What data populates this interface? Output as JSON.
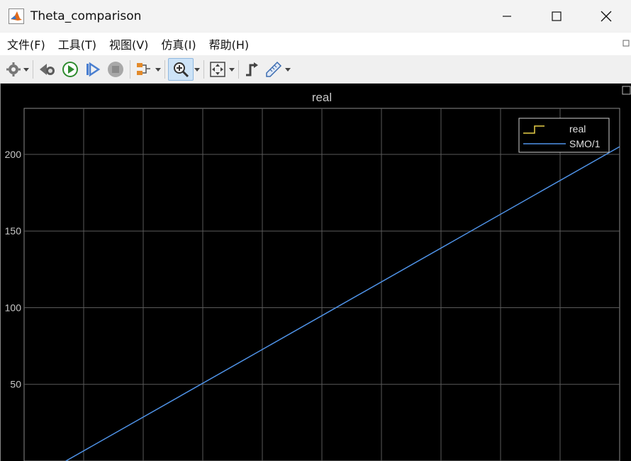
{
  "window": {
    "title": "Theta_comparison"
  },
  "menu": {
    "items": [
      {
        "label": "文件(F)"
      },
      {
        "label": "工具(T)"
      },
      {
        "label": "视图(V)"
      },
      {
        "label": "仿真(I)"
      },
      {
        "label": "帮助(H)"
      }
    ]
  },
  "toolbar": {
    "icons": [
      "settings-icon",
      "step-back-icon",
      "run-icon",
      "step-forward-icon",
      "stop-icon",
      "signal-select-icon",
      "zoom-in-icon",
      "fit-to-view-icon",
      "cursor-measure-icon",
      "triggers-icon"
    ]
  },
  "colors": {
    "plot_background": "#000000",
    "grid": "#5a5a5a",
    "axis_text": "#c8c8c8",
    "real_series": "#e8d048",
    "smo_series": "#4f93e8"
  },
  "chart_data": {
    "type": "line",
    "title": "real",
    "xlabel": "",
    "ylabel": "",
    "ylim": [
      0,
      230
    ],
    "xlim": [
      0,
      10
    ],
    "y_ticks": [
      50,
      100,
      150,
      200
    ],
    "grid": true,
    "legend_placement": "top-right",
    "series": [
      {
        "name": "real",
        "style": "stairs",
        "x": [],
        "y": []
      },
      {
        "name": "SMO/1",
        "style": "line",
        "x": [
          0.7,
          10
        ],
        "y": [
          0,
          205
        ]
      }
    ]
  }
}
